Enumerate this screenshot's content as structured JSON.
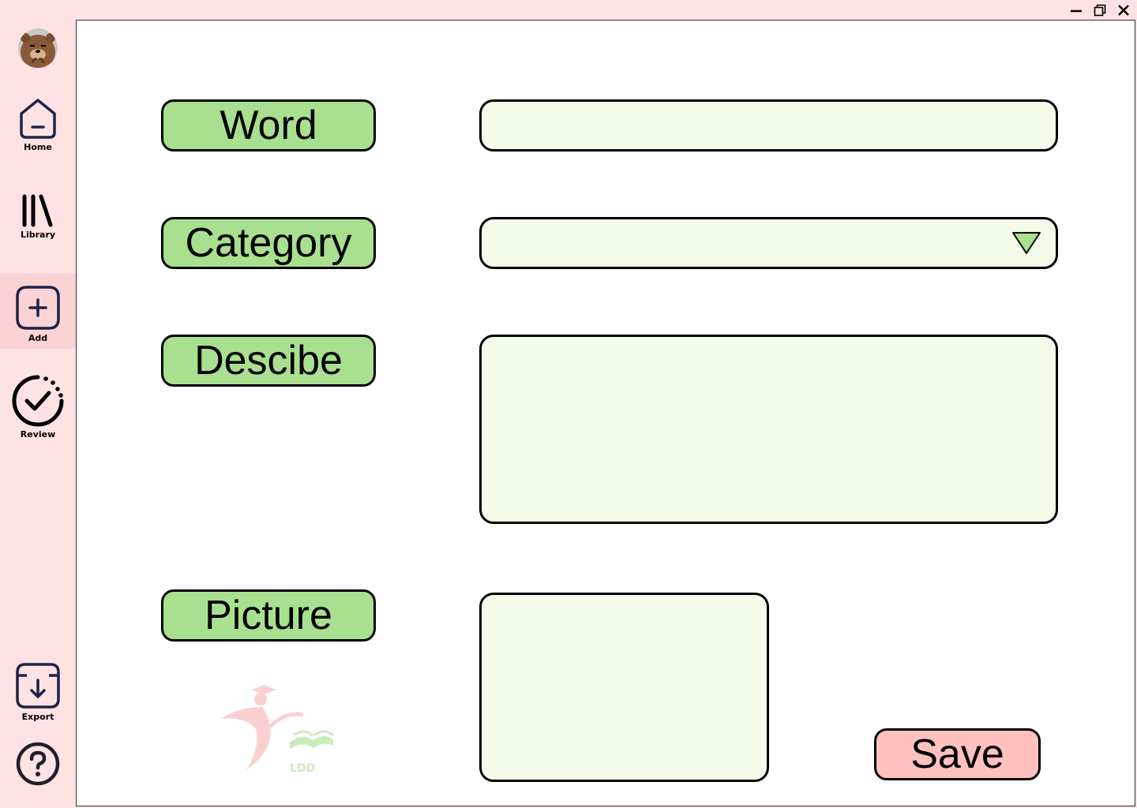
{
  "window": {
    "controls": [
      "minimize-icon",
      "restore-icon",
      "close-icon"
    ]
  },
  "sidebar": {
    "items": [
      {
        "label": "Home",
        "icon": "home-icon"
      },
      {
        "label": "Library",
        "icon": "library-icon"
      },
      {
        "label": "Add",
        "icon": "add-icon",
        "active": true
      },
      {
        "label": "Review",
        "icon": "review-icon"
      },
      {
        "label": "Export",
        "icon": "export-icon"
      }
    ],
    "help_icon": "help-icon"
  },
  "form": {
    "word_label": "Word",
    "category_label": "Category",
    "describe_label": "Descibe",
    "picture_label": "Picture",
    "word_value": "",
    "category_value": "",
    "describe_value": "",
    "save_label": "Save"
  },
  "logo": {
    "text": "LDD"
  },
  "colors": {
    "sidebar_bg": "#ffe3e4",
    "active_nav_bg": "#fcd3d5",
    "label_green": "#a9e090",
    "field_bg": "#f2fce8",
    "save_pink": "#ffc0c0",
    "icon_navy": "#1f2347"
  }
}
